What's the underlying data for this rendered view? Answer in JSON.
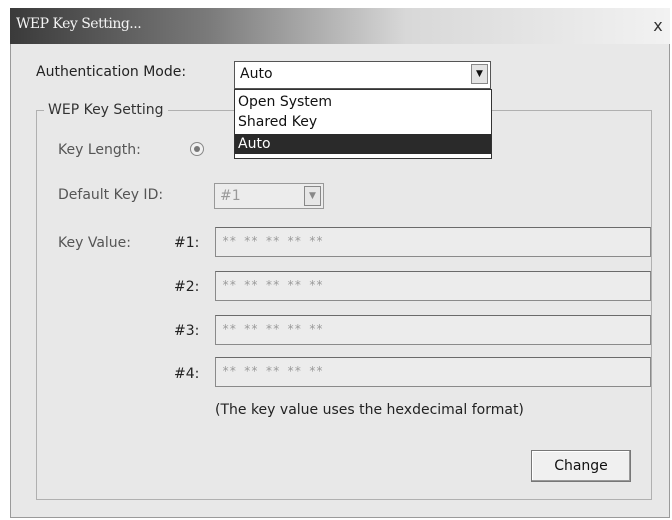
{
  "window": {
    "title": "WEP Key Setting...",
    "close_glyph": "x"
  },
  "auth": {
    "label": "Authentication Mode:",
    "value": "Auto",
    "arrow": "▼",
    "options": [
      {
        "label": "Open System"
      },
      {
        "label": "Shared Key"
      },
      {
        "label": "Auto",
        "selected": true
      }
    ]
  },
  "group": {
    "legend": "WEP Key Setting",
    "key_length_label": "Key Length:",
    "default_key_id_label": "Default Key ID:",
    "default_key_id_value": "#1",
    "key_value_label": "Key Value:",
    "keys": [
      {
        "id": "#1:",
        "value": "** ** ** ** **"
      },
      {
        "id": "#2:",
        "value": "** ** ** ** **"
      },
      {
        "id": "#3:",
        "value": "** ** ** ** **"
      },
      {
        "id": "#4:",
        "value": "** ** ** ** **"
      }
    ],
    "hint": "(The key value uses the hexdecimal format)",
    "change_button": "Change"
  }
}
